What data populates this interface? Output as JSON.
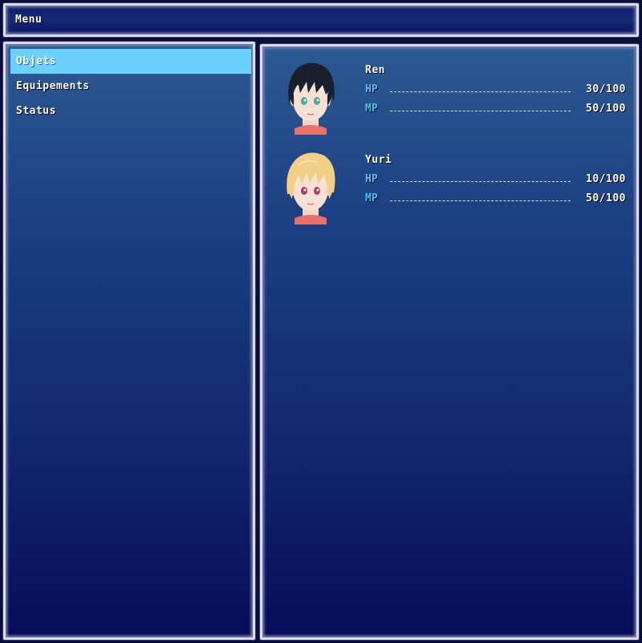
{
  "title_window": {
    "label": "Menu"
  },
  "commands": [
    {
      "label": "Objets",
      "selected": true
    },
    {
      "label": "Equipements",
      "selected": false
    },
    {
      "label": "Status",
      "selected": false
    }
  ],
  "party": [
    {
      "name": "Ren",
      "hair_color": "#1a1f2e",
      "eye_color": "#3fae9a",
      "stats": [
        {
          "label": "HP",
          "value": "30/100"
        },
        {
          "label": "MP",
          "value": "50/100"
        }
      ]
    },
    {
      "name": "Yuri",
      "hair_color": "#f1cf84",
      "eye_color": "#b23a6a",
      "stats": [
        {
          "label": "HP",
          "value": "10/100"
        },
        {
          "label": "MP",
          "value": "50/100"
        }
      ]
    }
  ],
  "colors": {
    "selection": "#6bd2ff",
    "stat_label": "#3fc8ff",
    "window_top": "#2c5a92",
    "window_bottom": "#060c5a"
  }
}
